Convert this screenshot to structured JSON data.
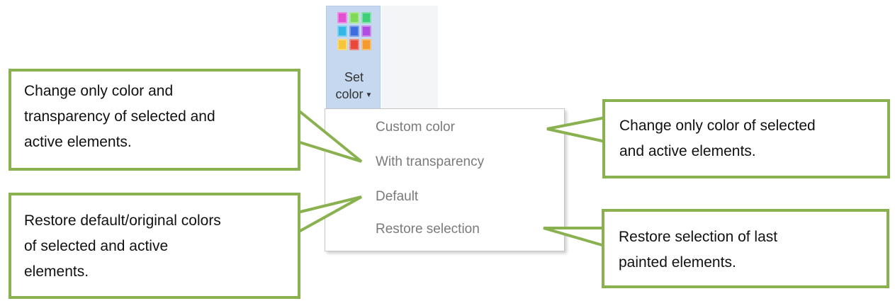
{
  "ribbon": {
    "set_color_line1": "Set",
    "set_color_line2": "color",
    "caret_icon": "caret-down-icon",
    "swatch_colors": [
      "#e24fd2",
      "#7ed957",
      "#3fcf7a",
      "#35b7e6",
      "#3e6de0",
      "#b04ce0",
      "#f6c53a",
      "#e8473a",
      "#f59a2e"
    ]
  },
  "menu": {
    "items": [
      "Custom color",
      "With transparency",
      "Default",
      "Restore selection"
    ]
  },
  "callouts": {
    "transparency": [
      "Change only color and",
      "transparency of selected and",
      "active elements."
    ],
    "custom_color": [
      "Change only color of selected",
      "and active elements."
    ],
    "default": [
      "Restore default/original colors",
      "of selected and active",
      "elements."
    ],
    "restore_selection": [
      "Restore selection of last",
      "painted elements."
    ]
  },
  "colors": {
    "callout_border": "#8ab14f",
    "ribbon_highlight": "#c5d8ef",
    "menu_text": "#7a7a7a"
  }
}
